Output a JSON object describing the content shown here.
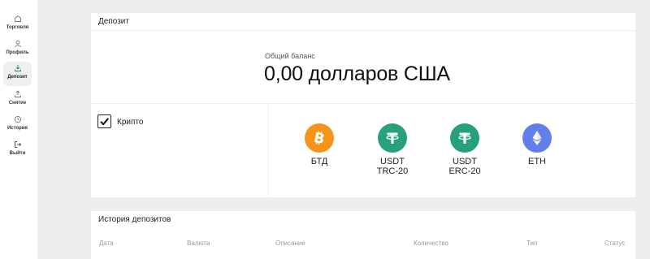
{
  "sidebar": {
    "items": [
      {
        "label": "Торговля",
        "icon": "home-icon",
        "active": false
      },
      {
        "label": "Профиль",
        "icon": "user-icon",
        "active": false
      },
      {
        "label": "Депозит",
        "icon": "download-icon",
        "active": true
      },
      {
        "label": "Снятие",
        "icon": "upload-icon",
        "active": false
      },
      {
        "label": "История",
        "icon": "clock-icon",
        "active": false
      },
      {
        "label": "Выйти",
        "icon": "logout-icon",
        "active": false
      }
    ]
  },
  "deposit": {
    "title": "Депозит",
    "balance_label": "Общий баланс",
    "balance_value": "0,00 долларов США",
    "method_label": "Крипто",
    "method_checked": true,
    "coins": [
      {
        "name": "БТД",
        "sub": "",
        "icon": "bitcoin-icon",
        "color": "#f7931a"
      },
      {
        "name": "USDT",
        "sub": "TRC-20",
        "icon": "tether-icon",
        "color": "#26a17b"
      },
      {
        "name": "USDT",
        "sub": "ERC-20",
        "icon": "tether-icon",
        "color": "#26a17b"
      },
      {
        "name": "ETH",
        "sub": "",
        "icon": "ethereum-icon",
        "color": "#627eea"
      }
    ]
  },
  "history": {
    "title": "История депозитов",
    "columns": [
      "Дата",
      "Валюта",
      "Описание",
      "Количество",
      "Тип",
      "Статус"
    ]
  }
}
